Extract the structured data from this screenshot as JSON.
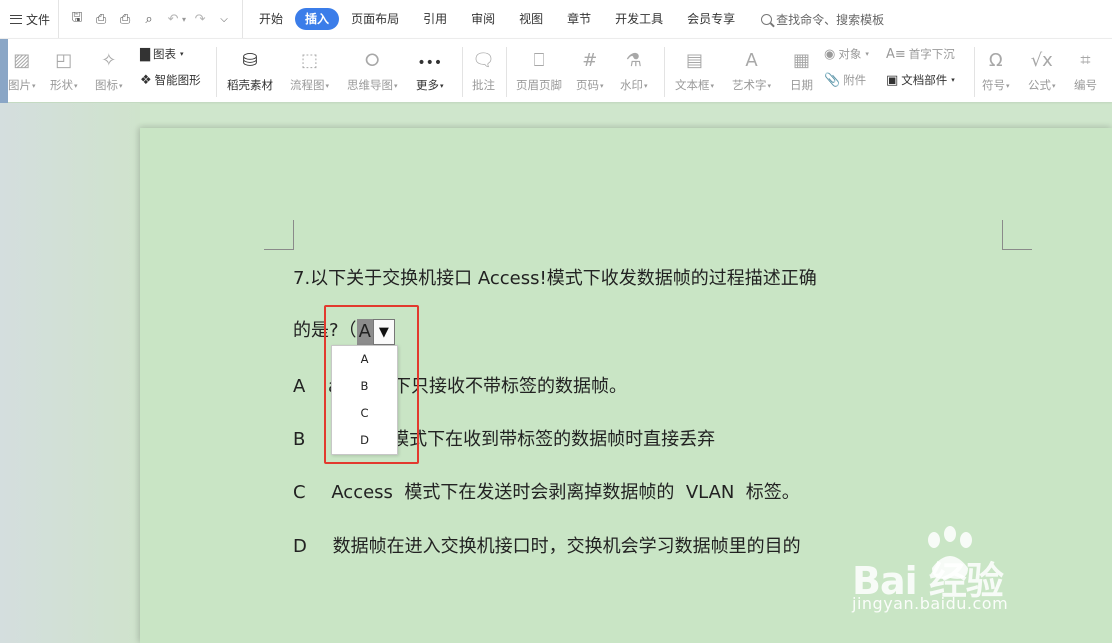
{
  "menubar": {
    "file_label": "文件",
    "tabs": [
      {
        "label": "开始",
        "active": false
      },
      {
        "label": "插入",
        "active": true
      },
      {
        "label": "页面布局",
        "active": false
      },
      {
        "label": "引用",
        "active": false
      },
      {
        "label": "审阅",
        "active": false
      },
      {
        "label": "视图",
        "active": false
      },
      {
        "label": "章节",
        "active": false
      },
      {
        "label": "开发工具",
        "active": false
      },
      {
        "label": "会员专享",
        "active": false
      }
    ],
    "search_label": "查找命令、搜索模板"
  },
  "ribbon": {
    "picture": "图片",
    "shape": "形状",
    "icon": "图标",
    "chart": "图表",
    "smart_graphic": "智能图形",
    "daoke": "稻壳素材",
    "flowchart": "流程图",
    "mindmap": "思维导图",
    "more": "更多",
    "comment": "批注",
    "header_footer": "页眉页脚",
    "page_number": "页码",
    "watermark": "水印",
    "textbox": "文本框",
    "wordart": "艺术字",
    "date": "日期",
    "object": "对象",
    "attachment": "附件",
    "dropcap": "首字下沉",
    "doc_parts": "文档部件",
    "symbol": "符号",
    "formula": "公式",
    "numbering": "编号"
  },
  "document": {
    "question_line1": "7.以下关于交换机接口 Access!模式下收发数据帧的过程描述正确",
    "question_line2_prefix": "的是?（",
    "answer_value": "A",
    "dropdown_arrow": "▼",
    "dropdown_options": [
      "A",
      "B",
      "C",
      "D"
    ],
    "options": [
      {
        "letter": "A",
        "visible_text": "模式下只接收不带标签的数据帧。"
      },
      {
        "letter": "B",
        "visible_text": "模式下在收到带标签的数据帧时直接丢弃"
      },
      {
        "letter": "C",
        "visible_text": "Access  模式下在发送时会剥离掉数据帧的  VLAN  标签。"
      },
      {
        "letter": "D",
        "visible_text": "数据帧在进入交换机接口时，交换机会学习数据帧里的目的"
      }
    ],
    "option_a_fragment": "a"
  },
  "watermark": {
    "logo_text": "Bai  经验",
    "url": "jingyan.baidu.com"
  },
  "colors": {
    "accent": "#3b7de9",
    "page_bg": "#c9e5c5",
    "highlight_box": "#e23a2e"
  }
}
